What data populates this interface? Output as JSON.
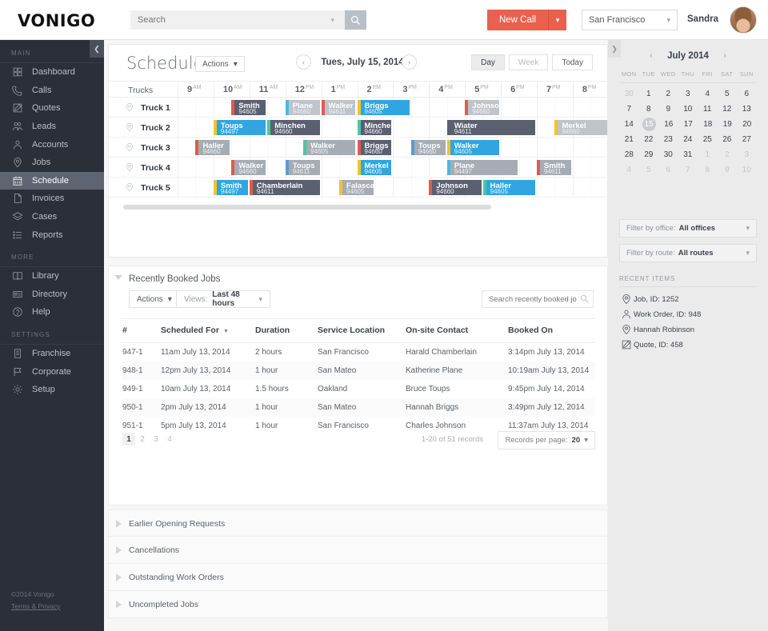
{
  "topbar": {
    "logo": "VONIGO",
    "search_placeholder": "Search",
    "search_value": "",
    "new_call_label": "New Call",
    "new_call_caret": "⌄",
    "office": "San Francisco",
    "username": "Sandra"
  },
  "sidebar": {
    "groups": [
      {
        "label": "MAIN",
        "items": [
          {
            "label": "Dashboard",
            "icon": "grid-icon",
            "active": false
          },
          {
            "label": "Calls",
            "icon": "phone-icon",
            "active": false
          },
          {
            "label": "Quotes",
            "icon": "pencil-square-icon",
            "active": false
          },
          {
            "label": "Leads",
            "icon": "users-icon",
            "active": false
          },
          {
            "label": "Accounts",
            "icon": "user-icon",
            "active": false
          },
          {
            "label": "Jobs",
            "icon": "map-pin-icon",
            "active": false
          },
          {
            "label": "Schedule",
            "icon": "calendar-icon",
            "active": true
          },
          {
            "label": "Invoices",
            "icon": "document-icon",
            "active": false
          },
          {
            "label": "Cases",
            "icon": "layers-icon",
            "active": false
          },
          {
            "label": "Reports",
            "icon": "list-icon",
            "active": false
          }
        ]
      },
      {
        "label": "MORE",
        "items": [
          {
            "label": "Library",
            "icon": "book-icon",
            "active": false
          },
          {
            "label": "Directory",
            "icon": "id-card-icon",
            "active": false
          },
          {
            "label": "Help",
            "icon": "question-circle-icon",
            "active": false
          }
        ]
      },
      {
        "label": "SETTINGS",
        "items": [
          {
            "label": "Franchise",
            "icon": "building-icon",
            "active": false
          },
          {
            "label": "Corporate",
            "icon": "flag-icon",
            "active": false
          },
          {
            "label": "Setup",
            "icon": "gear-icon",
            "active": false
          }
        ]
      }
    ],
    "footer_copyright": "©2014 Vonigo",
    "footer_terms": "Terms & Privacy"
  },
  "schedule": {
    "title": "Schedule",
    "actions_label": "Actions",
    "date_label": "Tues, July 15, 2014",
    "prev_arrow": "‹",
    "next_arrow": "›",
    "view_buttons": [
      {
        "label": "Day",
        "state": "active"
      },
      {
        "label": "Week",
        "state": "muted"
      },
      {
        "label": "Today",
        "state": "normal"
      }
    ],
    "trucks_header": "Trucks",
    "hours": [
      {
        "num": "9",
        "mer": "AM"
      },
      {
        "num": "10",
        "mer": "AM"
      },
      {
        "num": "11",
        "mer": "AM"
      },
      {
        "num": "12",
        "mer": "PM"
      },
      {
        "num": "1",
        "mer": "PM"
      },
      {
        "num": "2",
        "mer": "PM"
      },
      {
        "num": "3",
        "mer": "PM"
      },
      {
        "num": "4",
        "mer": "PM"
      },
      {
        "num": "5",
        "mer": "PM"
      },
      {
        "num": "6",
        "mer": "PM"
      },
      {
        "num": "7",
        "mer": "PM"
      },
      {
        "num": "8",
        "mer": "PM"
      }
    ],
    "rows": [
      {
        "label": "Truck 1",
        "events": [
          {
            "name": "Smith",
            "id": "94605",
            "start": 1.5,
            "end": 2.5,
            "color": "dark",
            "bar": "#e05a4f"
          },
          {
            "name": "Plane",
            "id": "94660",
            "start": 3.0,
            "end": 4.0,
            "color": "lightgray",
            "bar": "#49b6e8"
          },
          {
            "name": "Walker",
            "id": "94611",
            "start": 4.0,
            "end": 5.0,
            "color": "lightgray",
            "bar": "#e05a4f"
          },
          {
            "name": "Briggs",
            "id": "94605",
            "start": 5.0,
            "end": 6.5,
            "color": "blue",
            "bar": "#f2c230"
          },
          {
            "name": "Johnson",
            "id": "94660",
            "start": 8.0,
            "end": 9.0,
            "color": "lightgray",
            "bar": "#e05a4f"
          }
        ]
      },
      {
        "label": "Truck 2",
        "events": [
          {
            "name": "Toups",
            "id": "94497",
            "start": 1.0,
            "end": 2.5,
            "color": "blue",
            "bar": "#f2c230"
          },
          {
            "name": "Minchen",
            "id": "94660",
            "start": 2.5,
            "end": 4.0,
            "color": "dark",
            "bar": "#4cc5a5"
          },
          {
            "name": "Minchen",
            "id": "94660",
            "start": 5.0,
            "end": 6.0,
            "color": "dark",
            "bar": "#4cc5a5"
          },
          {
            "name": "Wiater",
            "id": "94611",
            "start": 7.5,
            "end": 10.0,
            "color": "dark",
            "bar": "#5a6070"
          },
          {
            "name": "Merkel",
            "id": "94660",
            "start": 10.5,
            "end": 12.0,
            "color": "lightgray",
            "bar": "#f2c230"
          }
        ]
      },
      {
        "label": "Truck 3",
        "events": [
          {
            "name": "Haller",
            "id": "94660",
            "start": 0.5,
            "end": 1.5,
            "color": "gray",
            "bar": "#e05a4f"
          },
          {
            "name": "Walker",
            "id": "94605",
            "start": 3.5,
            "end": 5.0,
            "color": "gray",
            "bar": "#4cc5a5"
          },
          {
            "name": "Briggs",
            "id": "94660",
            "start": 5.0,
            "end": 6.0,
            "color": "dark",
            "bar": "#e05a4f"
          },
          {
            "name": "Toups",
            "id": "94660",
            "start": 6.5,
            "end": 7.5,
            "color": "gray",
            "bar": "#5b9bd5"
          },
          {
            "name": "Walker",
            "id": "94605",
            "start": 7.5,
            "end": 9.0,
            "color": "blue",
            "bar": "#f2c230"
          }
        ]
      },
      {
        "label": "Truck 4",
        "events": [
          {
            "name": "Walker",
            "id": "94660",
            "start": 1.5,
            "end": 2.5,
            "color": "gray",
            "bar": "#e05a4f"
          },
          {
            "name": "Toups",
            "id": "94611",
            "start": 3.0,
            "end": 4.0,
            "color": "gray",
            "bar": "#5b9bd5"
          },
          {
            "name": "Merkel",
            "id": "94605",
            "start": 5.0,
            "end": 6.0,
            "color": "blue",
            "bar": "#f2c230"
          },
          {
            "name": "Plane",
            "id": "94497",
            "start": 7.5,
            "end": 9.5,
            "color": "gray",
            "bar": "#49b6e8"
          },
          {
            "name": "Smith",
            "id": "94611",
            "start": 10.0,
            "end": 11.0,
            "color": "gray",
            "bar": "#e05a4f"
          }
        ]
      },
      {
        "label": "Truck 5",
        "events": [
          {
            "name": "Smith",
            "id": "94497",
            "start": 1.0,
            "end": 2.0,
            "color": "blue",
            "bar": "#f2c230"
          },
          {
            "name": "Chamberlain",
            "id": "94611",
            "start": 2.0,
            "end": 4.0,
            "color": "dark",
            "bar": "#e05a4f"
          },
          {
            "name": "Falasca",
            "id": "94605",
            "start": 4.5,
            "end": 5.5,
            "color": "gray",
            "bar": "#f2c230"
          },
          {
            "name": "Johnson",
            "id": "94660",
            "start": 7.0,
            "end": 8.5,
            "color": "dark",
            "bar": "#e05a4f"
          },
          {
            "name": "Haller",
            "id": "94605",
            "start": 8.5,
            "end": 10.0,
            "color": "blue",
            "bar": "#4cc5a5"
          }
        ]
      }
    ]
  },
  "recently_booked": {
    "title": "Recently Booked Jobs",
    "actions_label": "Actions",
    "views_label": "Views:",
    "views_value": "Last 48 hours",
    "search_placeholder": "Search recently booked jobs",
    "columns": [
      "#",
      "Scheduled For",
      "Duration",
      "Service Location",
      "On-site Contact",
      "Booked On"
    ],
    "sort_column": "Scheduled For",
    "rows": [
      {
        "num": "947-1",
        "scheduled": "11am July 13, 2014",
        "duration": "2 hours",
        "location": "San Francisco",
        "contact": "Harald Chamberlain",
        "booked": "3:14pm July 13, 2014"
      },
      {
        "num": "948-1",
        "scheduled": "12pm July 13, 2014",
        "duration": "1 hour",
        "location": "San Mateo",
        "contact": "Katherine Plane",
        "booked": "10:19am July 13, 2014"
      },
      {
        "num": "949-1",
        "scheduled": "10am July 13, 2014",
        "duration": "1.5 hours",
        "location": "Oakland",
        "contact": "Bruce Toups",
        "booked": "9:45pm July 14, 2014"
      },
      {
        "num": "950-1",
        "scheduled": "2pm July 13, 2014",
        "duration": "1 hour",
        "location": "San Mateo",
        "contact": "Hannah Briggs",
        "booked": "3:49pm July 12, 2014"
      },
      {
        "num": "951-1",
        "scheduled": "5pm July 13, 2014",
        "duration": "1 hour",
        "location": "San Francisco",
        "contact": "Charles Johnson",
        "booked": "11:37am July 13, 2014"
      }
    ],
    "pages": [
      "1",
      "2",
      "3",
      "4"
    ],
    "current_page": "1",
    "records_text": "1-20 of 51 records",
    "records_per_page_label": "Records per page:",
    "records_per_page_value": "20"
  },
  "accordions": [
    {
      "label": "Earlier Opening Requests"
    },
    {
      "label": "Cancellations"
    },
    {
      "label": "Outstanding Work Orders"
    },
    {
      "label": "Uncompleted Jobs"
    }
  ],
  "right_panel": {
    "calendar": {
      "title": "July 2014",
      "prev": "‹",
      "next": "›",
      "dow": [
        "MON",
        "TUE",
        "WED",
        "THU",
        "FRI",
        "SAT",
        "SUN"
      ],
      "weeks": [
        [
          {
            "d": "30",
            "m": true
          },
          {
            "d": "1"
          },
          {
            "d": "2"
          },
          {
            "d": "3"
          },
          {
            "d": "4"
          },
          {
            "d": "5"
          },
          {
            "d": "6"
          }
        ],
        [
          {
            "d": "7"
          },
          {
            "d": "8"
          },
          {
            "d": "9"
          },
          {
            "d": "10"
          },
          {
            "d": "11"
          },
          {
            "d": "12"
          },
          {
            "d": "13"
          }
        ],
        [
          {
            "d": "14"
          },
          {
            "d": "15",
            "today": true
          },
          {
            "d": "16"
          },
          {
            "d": "17"
          },
          {
            "d": "18"
          },
          {
            "d": "19"
          },
          {
            "d": "20"
          }
        ],
        [
          {
            "d": "21"
          },
          {
            "d": "22"
          },
          {
            "d": "23"
          },
          {
            "d": "24"
          },
          {
            "d": "25"
          },
          {
            "d": "26"
          },
          {
            "d": "27"
          }
        ],
        [
          {
            "d": "28"
          },
          {
            "d": "29"
          },
          {
            "d": "30"
          },
          {
            "d": "31"
          },
          {
            "d": "1",
            "m": true
          },
          {
            "d": "2",
            "m": true
          },
          {
            "d": "3",
            "m": true
          }
        ],
        [
          {
            "d": "4",
            "m": true
          },
          {
            "d": "5",
            "m": true
          },
          {
            "d": "6",
            "m": true
          },
          {
            "d": "7",
            "m": true
          },
          {
            "d": "8",
            "m": true
          },
          {
            "d": "9",
            "m": true
          },
          {
            "d": "10",
            "m": true
          }
        ]
      ]
    },
    "filter_office_label": "Filter by office:",
    "filter_office_value": "All offices",
    "filter_route_label": "Filter by route:",
    "filter_route_value": "All routes",
    "recent_items_header": "RECENT ITEMS",
    "recent_items": [
      {
        "label": "Job, ID: 1252",
        "icon": "map-pin-icon"
      },
      {
        "label": "Work Order, ID: 948",
        "icon": "user-icon"
      },
      {
        "label": "Hannah Robinson",
        "icon": "map-pin-icon"
      },
      {
        "label": "Quote, ID: 458",
        "icon": "pencil-square-icon"
      }
    ]
  }
}
